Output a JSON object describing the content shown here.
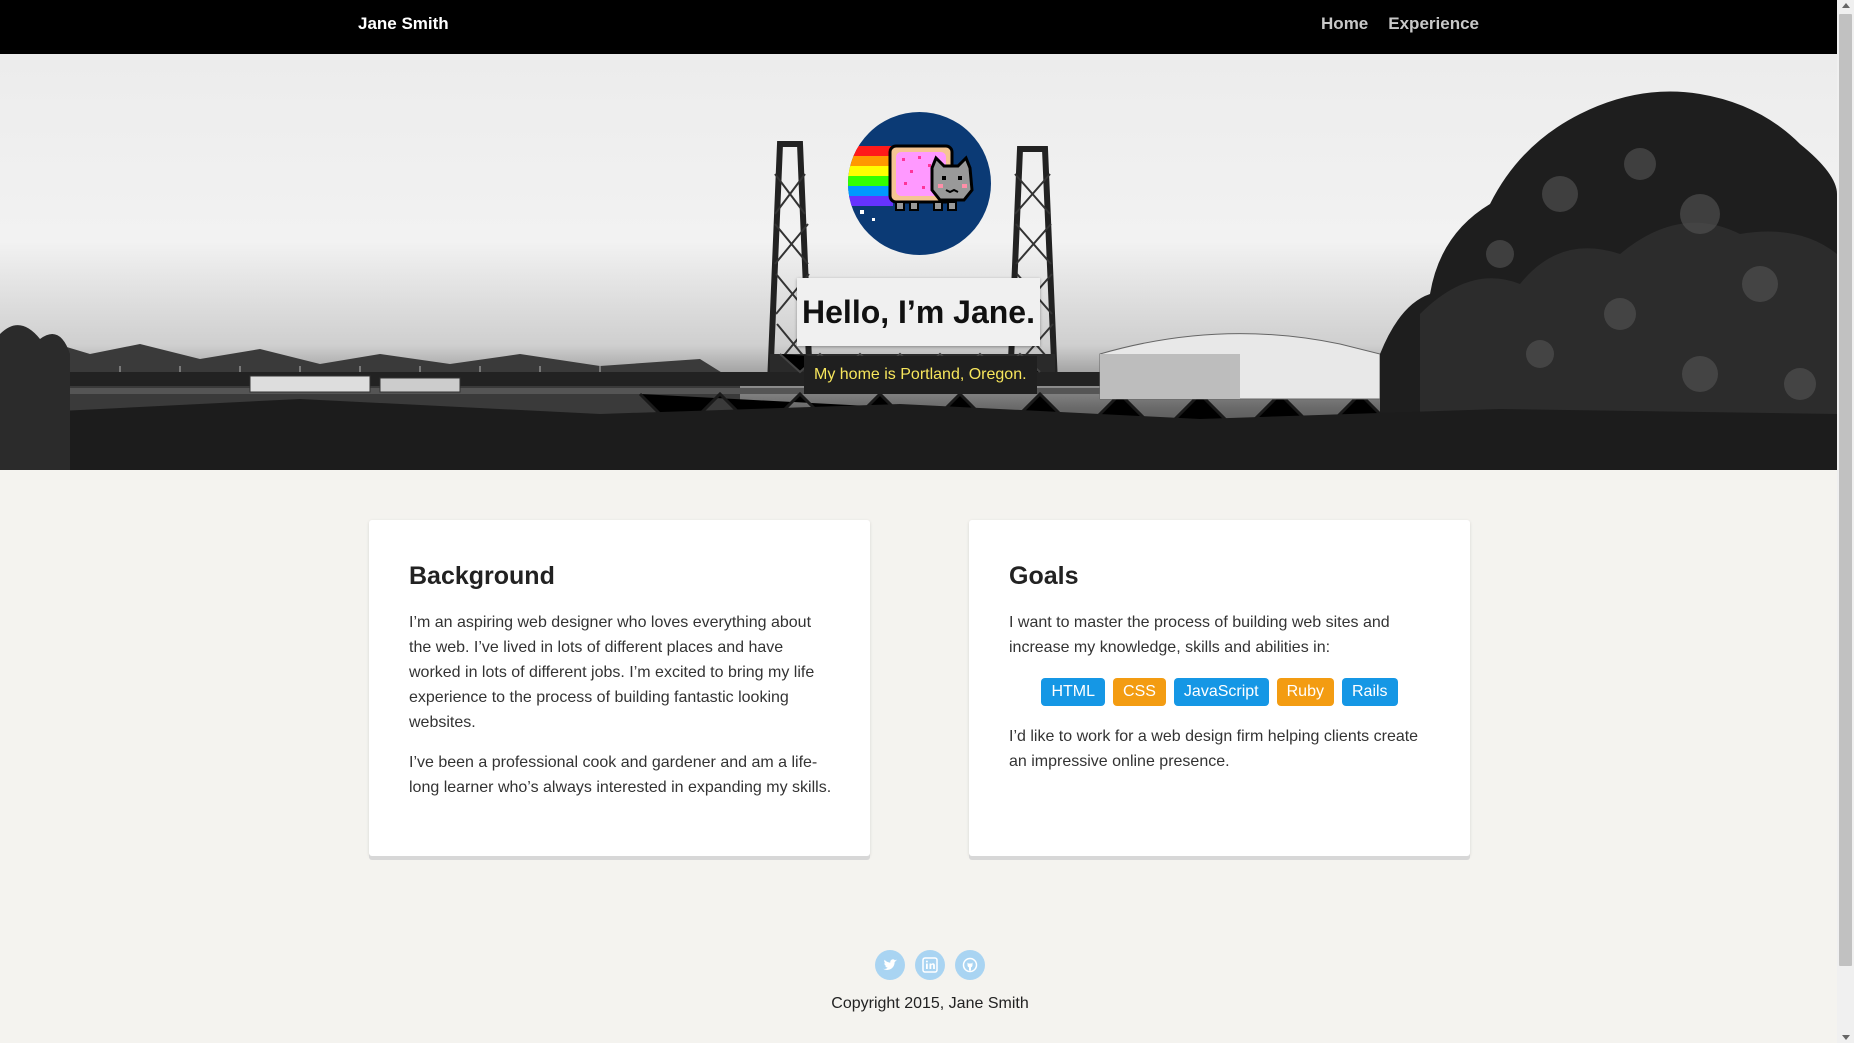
{
  "nav": {
    "brand": "Jane Smith",
    "links": [
      {
        "label": "Home"
      },
      {
        "label": "Experience"
      }
    ]
  },
  "hero": {
    "avatar_icon": "nyan-cat-icon",
    "heading": "Hello, I’m Jane.",
    "subheading": "My home is Portland, Oregon.",
    "background": "black-and-white Portland bridge photo"
  },
  "background_card": {
    "title": "Background",
    "paragraphs": [
      "I’m an aspiring web designer who loves everything about the web. I’ve lived in lots of different places and have worked in lots of different jobs. I’m excited to bring my life experience to the process of building fantastic looking websites.",
      "I’ve been a professional cook and gardener and am a life-long learner who’s always interested in expanding my skills."
    ]
  },
  "goals_card": {
    "title": "Goals",
    "intro": "I want to master the process of building web sites and increase my knowledge, skills and abilities in:",
    "tags": [
      {
        "label": "HTML",
        "color": "#1597e5"
      },
      {
        "label": "CSS",
        "color": "#f39c12"
      },
      {
        "label": "JavaScript",
        "color": "#1597e5"
      },
      {
        "label": "Ruby",
        "color": "#f39c12"
      },
      {
        "label": "Rails",
        "color": "#1597e5"
      }
    ],
    "outro": "I’d like to work for a web design firm helping clients create an impressive online presence."
  },
  "footer": {
    "social": [
      "twitter-icon",
      "linkedin-icon",
      "github-icon"
    ],
    "copyright": "Copyright 2015, Jane Smith"
  },
  "colors": {
    "nav_bg": "#000000",
    "page_bg": "#f4f3ef",
    "subheading_text": "#f7e65c",
    "social_icon_bg": "#a9d4f2"
  }
}
